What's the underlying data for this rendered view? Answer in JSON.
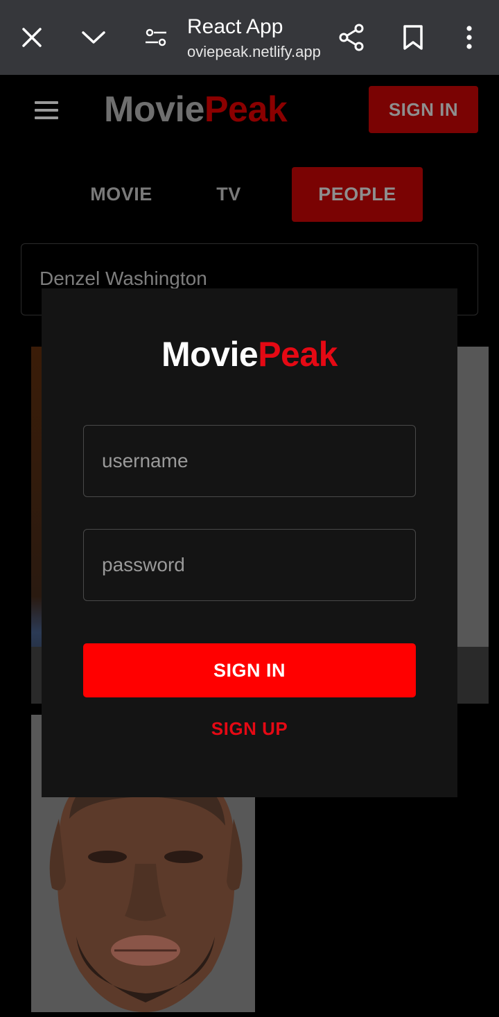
{
  "browser": {
    "title": "React App",
    "url": "oviepeak.netlify.app",
    "icons": [
      "close-icon",
      "chevron-down-icon",
      "site-settings-icon",
      "share-icon",
      "bookmark-icon",
      "more-vert-icon"
    ]
  },
  "header": {
    "brand_part1": "Movie",
    "brand_part2": "Peak",
    "sign_in_label": "SIGN IN"
  },
  "tabs": [
    {
      "label": "MOVIE",
      "active": false
    },
    {
      "label": "TV",
      "active": false
    },
    {
      "label": "PEOPLE",
      "active": true
    }
  ],
  "search": {
    "value": "Denzel Washington"
  },
  "modal": {
    "brand_part1": "Movie",
    "brand_part2": "Peak",
    "username_placeholder": "username",
    "password_placeholder": "password",
    "sign_in_label": "SIGN IN",
    "sign_up_label": "SIGN UP"
  },
  "colors": {
    "accent": "#e50914",
    "button_red": "#ff0000",
    "dim_red": "#7a0303",
    "modal_bg": "#141414",
    "chrome_bg": "#36373b"
  }
}
